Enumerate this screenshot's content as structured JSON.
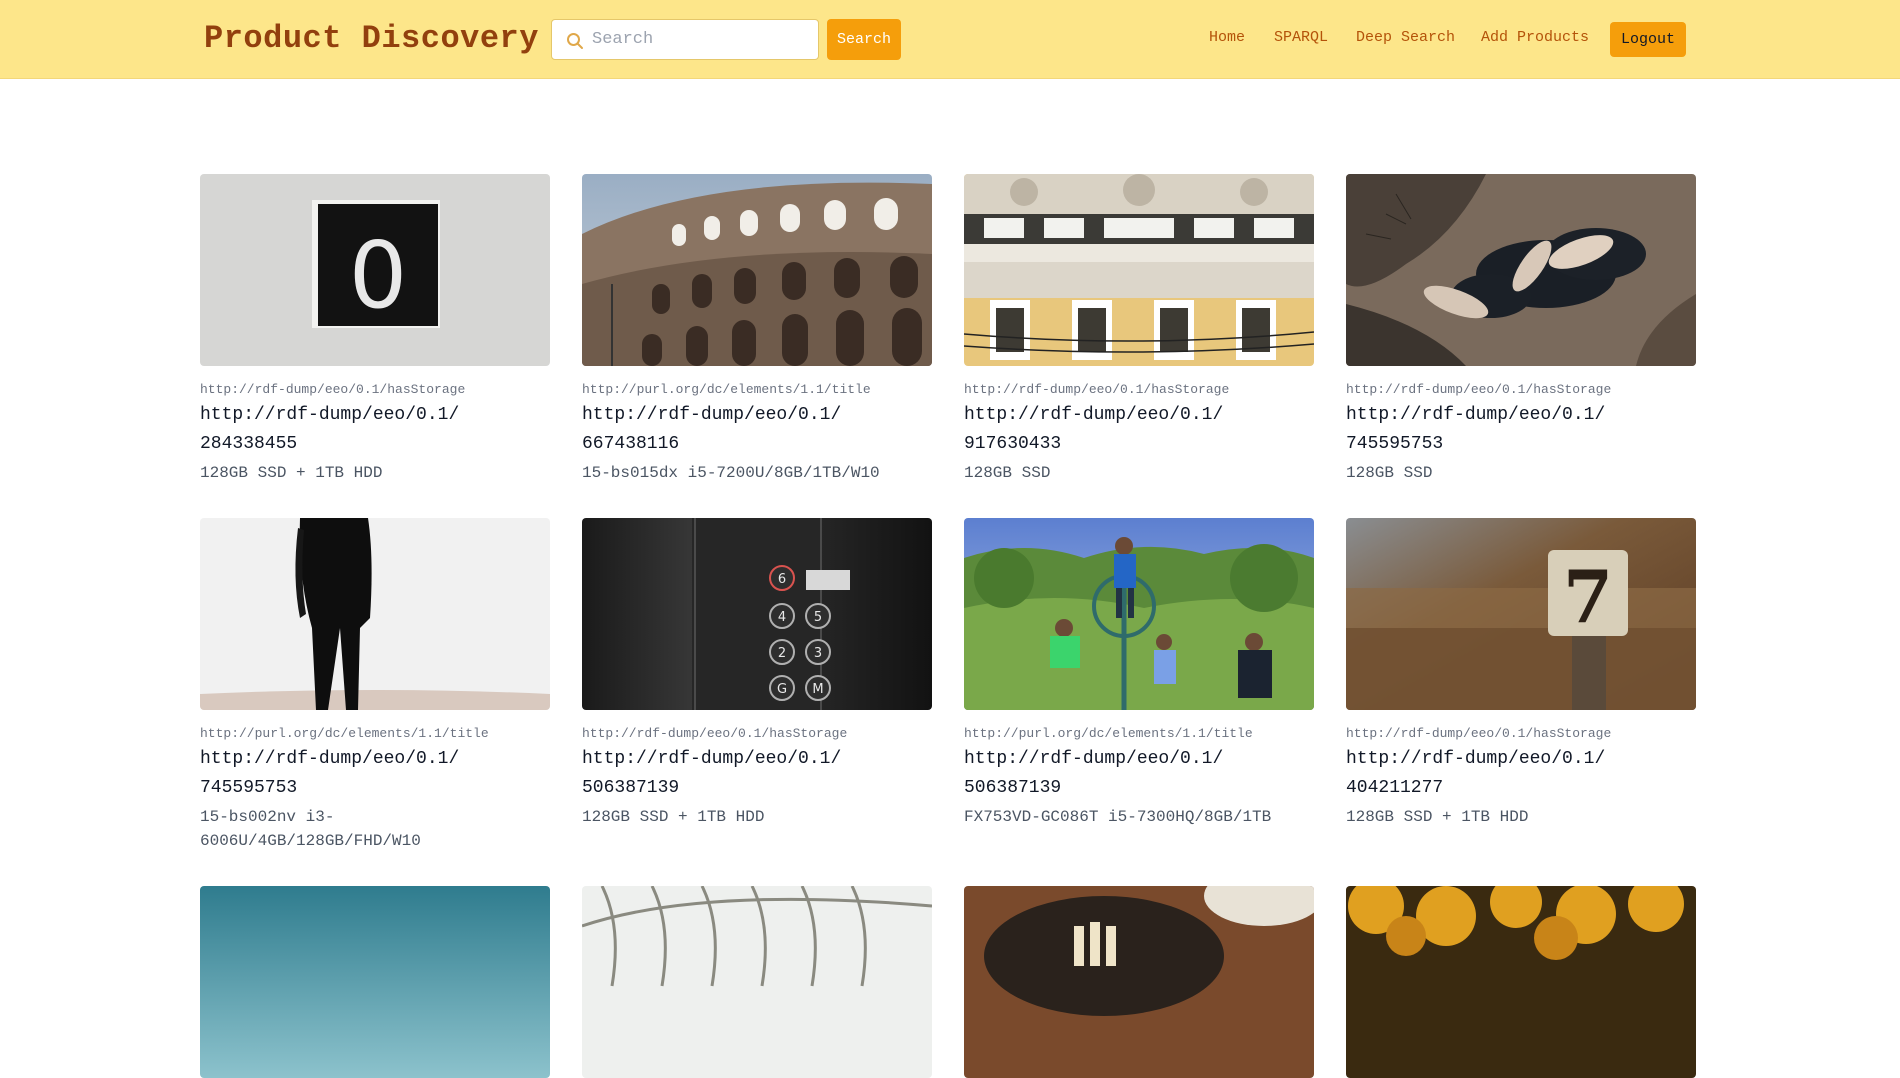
{
  "header": {
    "brand": "Product Discovery",
    "search_placeholder": "Search",
    "search_button": "Search",
    "nav": [
      "Home",
      "SPARQL",
      "Deep Search",
      "Add Products"
    ],
    "logout": "Logout",
    "colors": {
      "bar": "#fde68a",
      "accent": "#f59e0b",
      "brand_text": "#92400e",
      "nav_text": "#b45309"
    }
  },
  "products": [
    {
      "predicate": "http://rdf-dump/eeo/0.1/hasStorage",
      "subject": "http://rdf-dump/eeo/0.1/284338455",
      "value": "128GB SSD + 1TB HDD",
      "image": "number-zero-sign-photo"
    },
    {
      "predicate": "http://purl.org/dc/elements/1.1/title",
      "subject": "http://rdf-dump/eeo/0.1/667438116",
      "value": "15-bs015dx i5-7200U/8GB/1TB/W10",
      "image": "colosseum-photo"
    },
    {
      "predicate": "http://rdf-dump/eeo/0.1/hasStorage",
      "subject": "http://rdf-dump/eeo/0.1/917630433",
      "value": "128GB SSD",
      "image": "ornate-building-facade-photo"
    },
    {
      "predicate": "http://rdf-dump/eeo/0.1/hasStorage",
      "subject": "http://rdf-dump/eeo/0.1/745595753",
      "value": "128GB SSD",
      "image": "rhinos-aerial-photo"
    },
    {
      "predicate": "http://purl.org/dc/elements/1.1/title",
      "subject": "http://rdf-dump/eeo/0.1/745595753",
      "value": "15-bs002nv i3-6006U/4GB/128GB/FHD/W10",
      "image": "person-standing-photo"
    },
    {
      "predicate": "http://rdf-dump/eeo/0.1/hasStorage",
      "subject": "http://rdf-dump/eeo/0.1/506387139",
      "value": "128GB SSD + 1TB HDD",
      "image": "elevator-buttons-photo"
    },
    {
      "predicate": "http://purl.org/dc/elements/1.1/title",
      "subject": "http://rdf-dump/eeo/0.1/506387139",
      "value": "FX753VD-GC086T i5-7300HQ/8GB/1TB",
      "image": "children-playground-photo"
    },
    {
      "predicate": "http://rdf-dump/eeo/0.1/hasStorage",
      "subject": "http://rdf-dump/eeo/0.1/404211277",
      "value": "128GB SSD + 1TB HDD",
      "image": "number-seven-sign-photo"
    }
  ],
  "partial_row_images": [
    "teal-sky-photo",
    "glass-roof-photo",
    "food-plate-photo",
    "pumpkins-photo"
  ]
}
